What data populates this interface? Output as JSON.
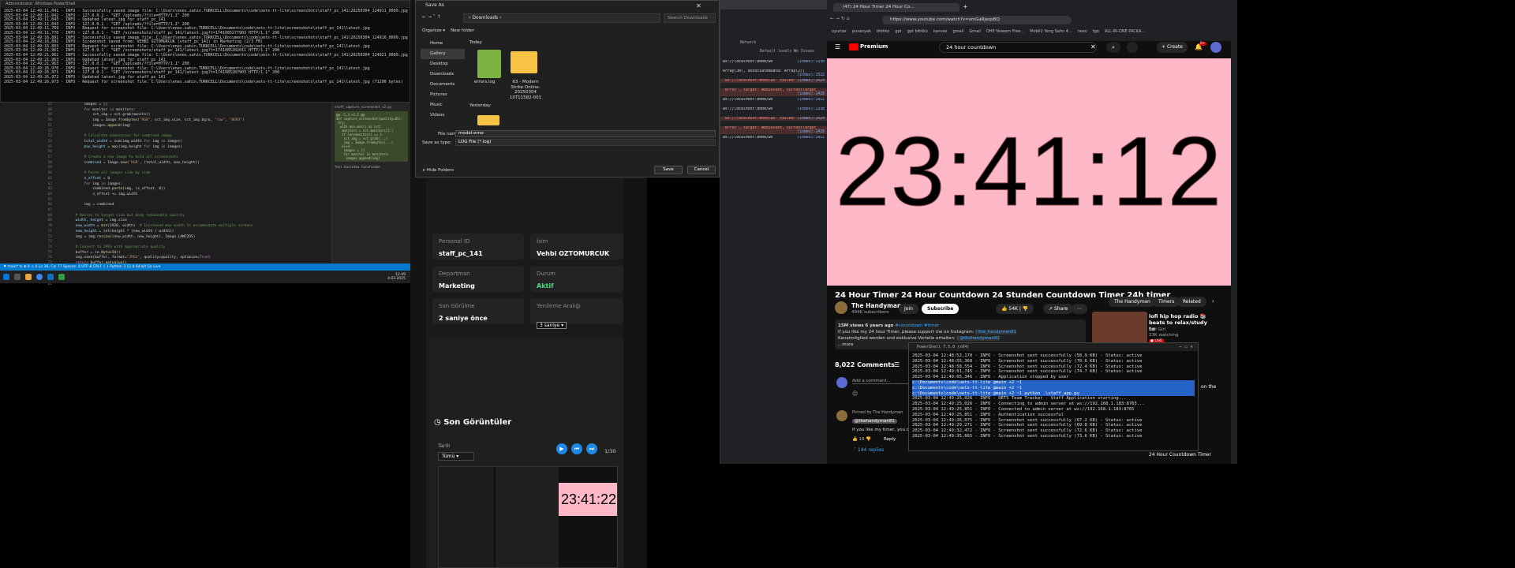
{
  "left_terminal": {
    "title": "Administrator: Windows PowerShell",
    "lines": [
      "2025-03-04 12:49:11,041 - INFO - Successfully saved image file: C:\\Users\\enes.sahin.TURKCELL\\Documents\\code\\oets-tt-lite\\screenshots\\staff_pc_141\\20250304_124911_0000.jpg (190882 bytes)",
      "2025-03-04 12:49:11,042 - INFO - 127.0.0.1 - \"GET /uploads/?file=HTTP/1.1\" 200",
      "2025-03-04 12:49:11,043 - INFO - Updated latest.jpg for staff_pc_141",
      "2025-03-04 12:49:11,043 - INFO - 127.0.0.1 - \"GET /uploads/?file=HTTP/1.1\" 200",
      "2025-03-04 12:49:11,769 - INFO - Request for screenshot file: C:\\Users\\enes.sahin.TURKCELL\\Documents\\code\\oets-tt-lite\\screenshots\\staff_pc_141\\latest.jpg",
      "2025-03-04 12:49:11,770 - INFO - 127.0.0.1 - \"GET /screenshots/staff_pc_141/latest.jpg?t=1741085277903 HTTP/1.1\" 200",
      "2025-03-04 12:49:16,891 - INFO - Successfully saved image file: C:\\Users\\enes.sahin.TURKCELL\\Documents\\code\\oets-tt-lite\\screenshots\\staff_pc_141\\20250304_124916_0000.jpg (74550 bytes)",
      "2025-03-04 12:49:16,892 - INFO - Screenshot saved from: VEHBI OZTOMURCUK (staff_pc_141) in Marketing (2/3 FB)",
      "2025-03-04 12:49:16,893 - INFO - Request for screenshot file: C:\\Users\\enes.sahin.TURKCELL\\Documents\\code\\oets-tt-lite\\screenshots\\staff_pc_141\\latest.jpg",
      "2025-03-04 12:49:21,961 - INFO - 127.0.0.1 - \"GET /screenshots/staff_pc_141/latest.jpg?t=1741085282011 HTTP/1.1\" 200",
      "2025-03-04 12:49:21,962 - INFO - Successfully saved image file: C:\\Users\\enes.sahin.TURKCELL\\Documents\\code\\oets-tt-lite\\screenshots\\staff_pc_141\\20250304_124921_0000.jpg (74550 bytes)",
      "2025-03-04 12:49:21,963 - INFO - Updated latest.jpg for staff_pc_141",
      "2025-03-04 12:49:21,963 - INFO - 127.0.0.1 - \"GET /uploads/?file=HTTP/1.1\" 200",
      "2025-03-04 12:49:26,970 - INFO - Request for screenshot file: C:\\Users\\enes.sahin.TURKCELL\\Documents\\code\\oets-tt-lite\\screenshots\\staff_pc_141\\latest.jpg",
      "2025-03-04 12:49:26,971 - INFO - 127.0.0.1 - \"GET /screenshots/staff_pc_141/latest.jpg?t=1741085287903 HTTP/1.1\" 200",
      "2025-03-04 12:49:26,972 - INFO - Updated latest.jpg for staff_pc_141",
      "2025-03-04 12:49:26,973 - INFO - Request for screenshot file: C:\\Users\\enes.sahin.TURKCELL\\Documents\\code\\oets-tt-lite\\screenshots\\staff_pc_141\\latest.jpg (71290 bytes)"
    ]
  },
  "editor": {
    "line_numbers": [
      "47",
      "48",
      "49",
      "50",
      "51",
      "52",
      "53",
      "54",
      "55",
      "56",
      "57",
      "58",
      "59",
      "60",
      "61",
      "62",
      "63",
      "64",
      "65",
      "66",
      "67",
      "68",
      "69",
      "70",
      "71",
      "72",
      "73",
      "74",
      "75",
      "76",
      "77",
      "78",
      "79",
      "80",
      "81"
    ],
    "status": "⚑ main* ↻ ⊗ 0 ⚠ 0    Ln 36, Col 77  Spaces: 4  UTF-8  CRLF  { } Python  3.12.0 64-bit  Go Live"
  },
  "minimap": {
    "title": "staff_capture_screenshot_v2.py",
    "diff_label": "@@ -1,3 +1,5 @@",
    "note": "Yeni baslatma tarafindan"
  },
  "taskbar_left": {
    "time": "12:49",
    "date": "4.03.2025"
  },
  "save_dialog": {
    "title": "Save As",
    "path": "Downloads",
    "search_placeholder": "Search Downloads",
    "organize": "Organize ▾",
    "new_folder": "New folder",
    "nav": [
      "Home",
      "Gallery",
      "Desktop",
      "Downloads",
      "Documents",
      "Pictures",
      "Music",
      "Videos"
    ],
    "group_today": "Today",
    "group_yesterday": "Yesterday",
    "file1": "errors.log",
    "file2": "63 - Modern Strike Online-20250304 10T11582-001",
    "file_name_label": "File name:",
    "file_name_value": "modal-error",
    "save_type_label": "Save as type:",
    "save_type_value": "LOG File (*.log)",
    "hide_folders": "Hide Folders",
    "save_button": "Save",
    "cancel_button": "Cancel"
  },
  "devtools": {
    "tab_network": "Network",
    "default_levels": "Default levels ▾",
    "no_issues": "No Issues",
    "rows": [
      {
        "t": "ws://localhost:8000/ws",
        "src": "(index):1338"
      },
      {
        "t": "Array(30), associatedData: Array(2)]",
        "src": "(index):1522"
      },
      {
        "t": "'ws://localhost:8000/ws' failed:",
        "src": "(index):1424"
      },
      {
        "t": "'error', target: WebSocket, currentTarget",
        "src": "(index):1416"
      },
      {
        "t": "ws://localhost:8000/ws",
        "src": "(index):1411"
      },
      {
        "t": "ws://localhost:8000/ws",
        "src": "(index):1338"
      },
      {
        "t": "'ws://localhost:8000/ws' failed:",
        "src": "(index):1424"
      },
      {
        "t": "'error', target: WebSocket, currentTarget",
        "src": "(index):1416"
      },
      {
        "t": "ws://localhost:8000/ws",
        "src": "(index):1411"
      }
    ]
  },
  "staff_app": {
    "personel_id_label": "Personel ID",
    "personel_id_value": "staff_pc_141",
    "isim_label": "İsim",
    "isim_value": "Vehbi OZTOMURCUK",
    "departman_label": "Departman",
    "departman_value": "Marketing",
    "durum_label": "Durum",
    "durum_value": "Aktif",
    "son_gorulme_label": "Son Görülme",
    "son_gorulme_value": "2 saniye önce",
    "yenileme_label": "Yenileme Aralığı",
    "yenileme_value": "3 saniye",
    "section_title": "Son Görüntüler",
    "tarih_label": "Tarih",
    "tarih_value": "Tümü",
    "counter": "1/30",
    "thumb_time": "23:41:22"
  },
  "youtube": {
    "tab_title": "(47) 24 Hour Timer 24 Hour Co…",
    "url": "https://www.youtube.com/watch?v=smGaRjeqsBQ",
    "bookmarks": [
      "oyunlar",
      "pusanyak",
      "bibliko",
      "gpt",
      "gpt bibliko",
      "kanvas",
      "gmail",
      "Gmail",
      "DHE Nowem Free...",
      "Mobil2 Yeng Sahn 4...",
      "nexo",
      "tgo",
      "ALL-IN-ONE PACKA..."
    ],
    "search_query": "24 hour countdown",
    "create": "Create",
    "notif_count": "9+",
    "timer": "23:41:12",
    "video_title": "24 Hour Timer 24 Hour Countdown 24 Stunden Countdown Timer 24h timer",
    "channel": "The Handyman",
    "subs": "494K subscribers",
    "join": "Join",
    "subscribe": "Subscribe",
    "likes": "54K",
    "share": "Share",
    "views": "15M views",
    "age": "6 years ago",
    "hashtags": "#countdown #timer",
    "desc": "If you like my 24 hour Timer, please support me on Instagram:",
    "insta": "/ the_handyman81",
    "desc2": "Kanalmitglied werden und exklusive Vorteile erhalten:",
    "member_link": "/ @thehandyman81",
    "more": "...more",
    "comments_count": "8,022 Comments",
    "add_comment": "Add a comment...",
    "pinned": "Pinned by The Handyman",
    "commenter": "@thehandyman81",
    "comment_text": "If you like my timer, you can...",
    "comment_likes": "16",
    "reply": "Reply",
    "replies": "144 replies",
    "chip1": "The Handyman",
    "chip2": "Timers",
    "chip3": "Related",
    "rec_title": "lofi hip hop radio 📚 beats to relax/study to",
    "rec_channel": "Lofi Girl",
    "rec_watching": "23K watching",
    "live": "LIVE",
    "on_the": "on the",
    "rec2": "24 Hour Countdown Timer"
  },
  "powershell": {
    "title": "PowerShell 7.5.0 (x64)",
    "lines": [
      "2025-03-04 12:48:52,170 - INFO - Screenshot sent successfully (58.9 KB) - Status: active",
      "2025-03-04 12:48:55,368 - INFO - Screenshot sent successfully (70.6 KB) - Status: active",
      "2025-03-04 12:48:58,554 - INFO - Screenshot sent successfully (72.4 KB) - Status: active",
      "2025-03-04 12:49:01,745 - INFO - Screenshot sent successfully (74.7 KB) - Status: active",
      "2025-03-04 12:49:05,346 - INFO - Application stopped by user"
    ],
    "hl_lines": [
      "c:\\Documents\\code\\oets-tt-lite  @main  +2 ~1",
      "c:\\Documents\\code\\oets-tt-lite  @main  +2 ~1",
      "c:\\Documents\\code\\oets-tt-lite  @main  +2 ~1  python .\\staff_app.py"
    ],
    "lines2": [
      "2025-03-04 12:49:25,026 - INFO - OETS Team Tracker - Staff Application starting...",
      "2025-03-04 12:49:25,026 - INFO - Connecting to admin server at ws://192.168.1.183:8765...",
      "2025-03-04 12:49:25,851 - INFO - Connected to admin server at ws://192.168.1.183:8765",
      "2025-03-04 12:49:25,851 - INFO - Authentication successful",
      "2025-03-04 12:49:26,075 - INFO - Screenshot sent successfully (67.2 KB) - Status: active",
      "2025-03-04 12:49:29,271 - INFO - Screenshot sent successfully (69.8 KB) - Status: active",
      "2025-03-04 12:49:32,472 - INFO - Screenshot sent successfully (72.6 KB) - Status: active",
      "2025-03-04 12:49:35,665 - INFO - Screenshot sent successfully (73.6 KB) - Status: active"
    ]
  }
}
